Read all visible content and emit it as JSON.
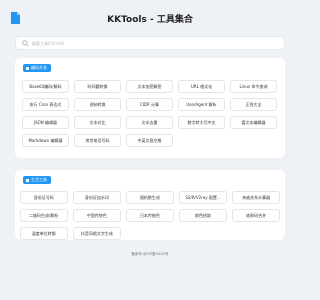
{
  "header": {
    "title": "KKTools - 工具集合",
    "logo": "document-icon"
  },
  "search": {
    "placeholder": "搜索工具(Ctrl+K)",
    "value": ""
  },
  "colors": {
    "accent": "#2196f3",
    "background": "#eef2f7",
    "card": "#ffffff"
  },
  "sections": {
    "dev": {
      "title": "编码开发",
      "items": [
        "Base64编码/解码",
        "时间戳转换",
        "文本加密解密",
        "URL 格式化",
        "Linux 命令查询",
        "执行 Cron 表达式",
        "进制转换",
        "CIDR 计算",
        "UserAgent 解析",
        "正则大全",
        "JSON 编辑器",
        "文本对比",
        "文本去重",
        "数字转大写中文",
        "富文本编辑器",
        "Markdown 编辑器",
        "房贷电话号码",
        "中英文段空格"
      ]
    },
    "life": {
      "title": "生活工具",
      "items": [
        "身份证号码",
        "身份证加水印",
        "随机数生成",
        "SS/R/V2ray 配置...",
        "亲戚关系计算器",
        "二维码生成/解析",
        "中国传统色",
        "日本传统色",
        "颜色拾取",
        "收款码合并",
        "温度单位转换",
        "抖音风格文字生成"
      ]
    }
  },
  "footer": {
    "text": "备案号:京ICP备XXXX号"
  }
}
